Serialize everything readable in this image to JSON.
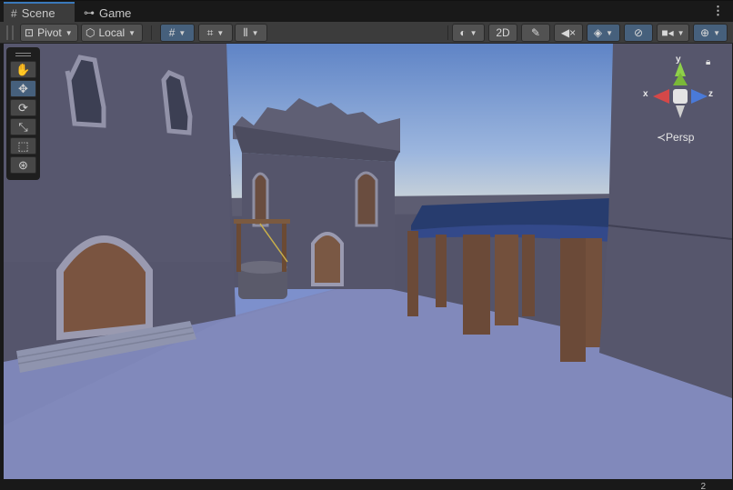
{
  "tabs": [
    {
      "label": "Scene",
      "icon": "grid-icon",
      "active": true
    },
    {
      "label": "Game",
      "icon": "gamepad-icon",
      "active": false
    }
  ],
  "toolbar": {
    "pivot_label": "Pivot",
    "local_label": "Local",
    "mode_2d_label": "2D",
    "accent_color": "#46607c"
  },
  "tools": [
    "hand-tool",
    "move-tool",
    "rotate-tool",
    "scale-tool",
    "rect-tool",
    "transform-tool"
  ],
  "gizmo": {
    "x_label": "x",
    "y_label": "y",
    "z_label": "z",
    "projection_label": "≺Persp",
    "x_color": "#d54848",
    "y_color": "#8ed04a",
    "z_color": "#4a7ad8"
  },
  "footer": {
    "page_indicator": "2"
  }
}
